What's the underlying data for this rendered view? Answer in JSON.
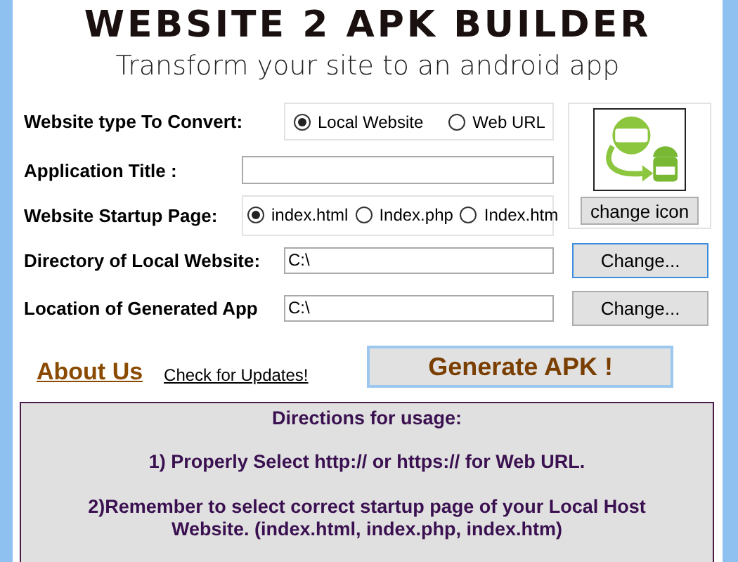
{
  "header": {
    "title": "WEBSITE 2 APK BUILDER",
    "subtitle": "Transform your site to an android app"
  },
  "website_type": {
    "label": "Website type To Convert:",
    "options": [
      {
        "label": "Local Website",
        "selected": true
      },
      {
        "label": "Web URL",
        "selected": false
      }
    ]
  },
  "app_title": {
    "label": "Application Title :"
  },
  "startup_page": {
    "label": "Website Startup Page:",
    "options": [
      {
        "label": "index.html",
        "selected": true
      },
      {
        "label": "Index.php",
        "selected": false
      },
      {
        "label": "Index.htm",
        "selected": false
      }
    ]
  },
  "icon_panel": {
    "button": "change icon"
  },
  "paths": [
    {
      "label": "Directory of Local Website:",
      "value": "C:\\",
      "button": "Change...",
      "focused": true
    },
    {
      "label": "Location of Generated App",
      "value": "C:\\",
      "button": "Change...",
      "focused": false
    }
  ],
  "links": [
    {
      "label": "About Us",
      "kind": "big"
    },
    {
      "label": "Check for Updates!",
      "kind": "small"
    }
  ],
  "generate_button": "Generate APK !",
  "directions": {
    "title": "Directions for usage:",
    "items": [
      "1) Properly Select http:// or https:// for Web URL.",
      "2)Remember to select correct startup page of your Local Host Website.  (index.html, index.php, index.htm)"
    ]
  }
}
